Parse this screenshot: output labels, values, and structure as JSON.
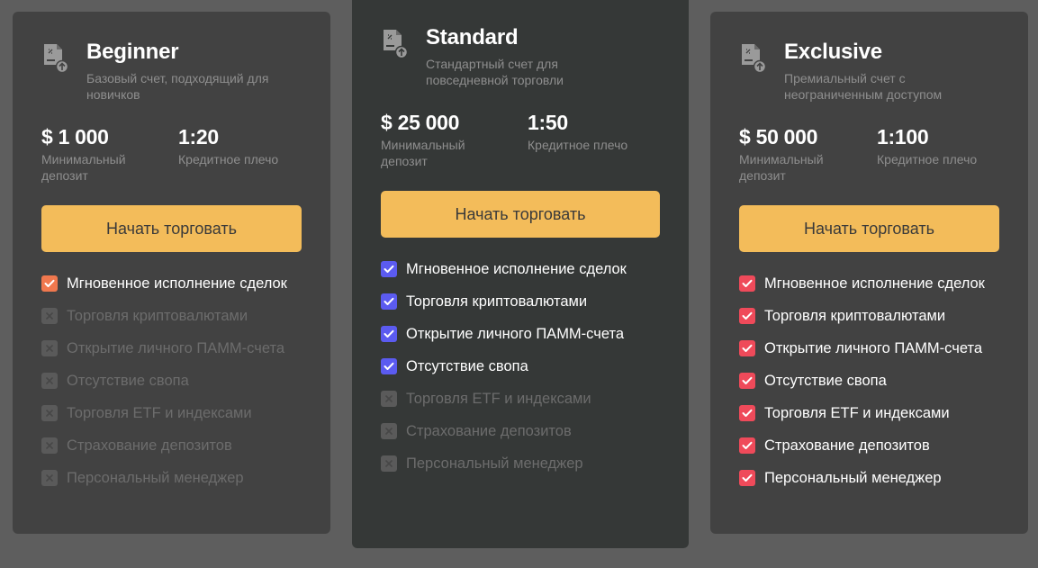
{
  "colors": {
    "page_bg": "#5e5e5e",
    "card_bg": "#424242",
    "featured_card_bg": "#353837",
    "cta_bg": "#f3bc5a",
    "muted_text": "#8e8e8e",
    "disabled_box": "#5a5a5a"
  },
  "plans": [
    {
      "name": "Beginner",
      "description": "Базовый счет, подходящий для новичков",
      "icon": "document-upload-icon",
      "deposit_value": "$ 1 000",
      "deposit_label": "Минимальный депозит",
      "leverage_value": "1:20",
      "leverage_label": "Кредитное плечо",
      "cta_label": "Начать торговать",
      "check_color": "#f0784e",
      "features": [
        {
          "label": "Мгновенное исполнение сделок",
          "enabled": true
        },
        {
          "label": "Торговля криптовалютами",
          "enabled": false
        },
        {
          "label": "Открытие личного ПАММ-счета",
          "enabled": false
        },
        {
          "label": "Отсутствие свопа",
          "enabled": false
        },
        {
          "label": "Торговля ETF и индексами",
          "enabled": false
        },
        {
          "label": "Страхование депозитов",
          "enabled": false
        },
        {
          "label": "Персональный менеджер",
          "enabled": false
        }
      ]
    },
    {
      "name": "Standard",
      "description": "Стандартный счет для повседневной торговли",
      "icon": "document-upload-icon",
      "deposit_value": "$ 25 000",
      "deposit_label": "Минимальный депозит",
      "leverage_value": "1:50",
      "leverage_label": "Кредитное плечо",
      "cta_label": "Начать торговать",
      "check_color": "#5b5bf0",
      "features": [
        {
          "label": "Мгновенное исполнение сделок",
          "enabled": true
        },
        {
          "label": "Торговля криптовалютами",
          "enabled": true
        },
        {
          "label": "Открытие личного ПАММ-счета",
          "enabled": true
        },
        {
          "label": "Отсутствие свопа",
          "enabled": true
        },
        {
          "label": "Торговля ETF и индексами",
          "enabled": false
        },
        {
          "label": "Страхование депозитов",
          "enabled": false
        },
        {
          "label": "Персональный менеджер",
          "enabled": false
        }
      ]
    },
    {
      "name": "Exclusive",
      "description": "Премиальный счет с неограниченным доступом",
      "icon": "document-upload-icon",
      "deposit_value": "$ 50 000",
      "deposit_label": "Минимальный депозит",
      "leverage_value": "1:100",
      "leverage_label": "Кредитное плечо",
      "cta_label": "Начать торговать",
      "check_color": "#ef4a5a",
      "features": [
        {
          "label": "Мгновенное исполнение сделок",
          "enabled": true
        },
        {
          "label": "Торговля криптовалютами",
          "enabled": true
        },
        {
          "label": "Открытие личного ПАММ-счета",
          "enabled": true
        },
        {
          "label": "Отсутствие свопа",
          "enabled": true
        },
        {
          "label": "Торговля ETF и индексами",
          "enabled": true
        },
        {
          "label": "Страхование депозитов",
          "enabled": true
        },
        {
          "label": "Персональный менеджер",
          "enabled": true
        }
      ]
    }
  ]
}
